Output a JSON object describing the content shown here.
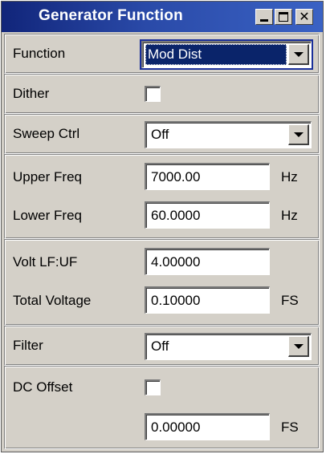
{
  "window": {
    "title": "Generator Function",
    "controls": {
      "minimize": "minimize-icon",
      "maximize": "maximize-icon",
      "close": "close-icon"
    }
  },
  "function": {
    "label": "Function",
    "value": "Mod Dist"
  },
  "dither": {
    "label": "Dither",
    "checked": false
  },
  "sweep": {
    "label": "Sweep Ctrl",
    "value": "Off"
  },
  "upper_freq": {
    "label": "Upper Freq",
    "value": "7000.00",
    "unit": "Hz"
  },
  "lower_freq": {
    "label": "Lower Freq",
    "value": "60.0000",
    "unit": "Hz"
  },
  "volt_ratio": {
    "label": "Volt LF:UF",
    "value": "4.00000"
  },
  "total_voltage": {
    "label": "Total Voltage",
    "value": "0.10000",
    "unit": "FS"
  },
  "filter": {
    "label": "Filter",
    "value": "Off"
  },
  "dc_offset": {
    "label": "DC Offset",
    "checked": false,
    "value": "0.00000",
    "unit": "FS"
  },
  "colors": {
    "title_start": "#11257a",
    "title_end": "#3a62c4",
    "panel": "#d4d0c8",
    "selection": "#0a246a"
  }
}
